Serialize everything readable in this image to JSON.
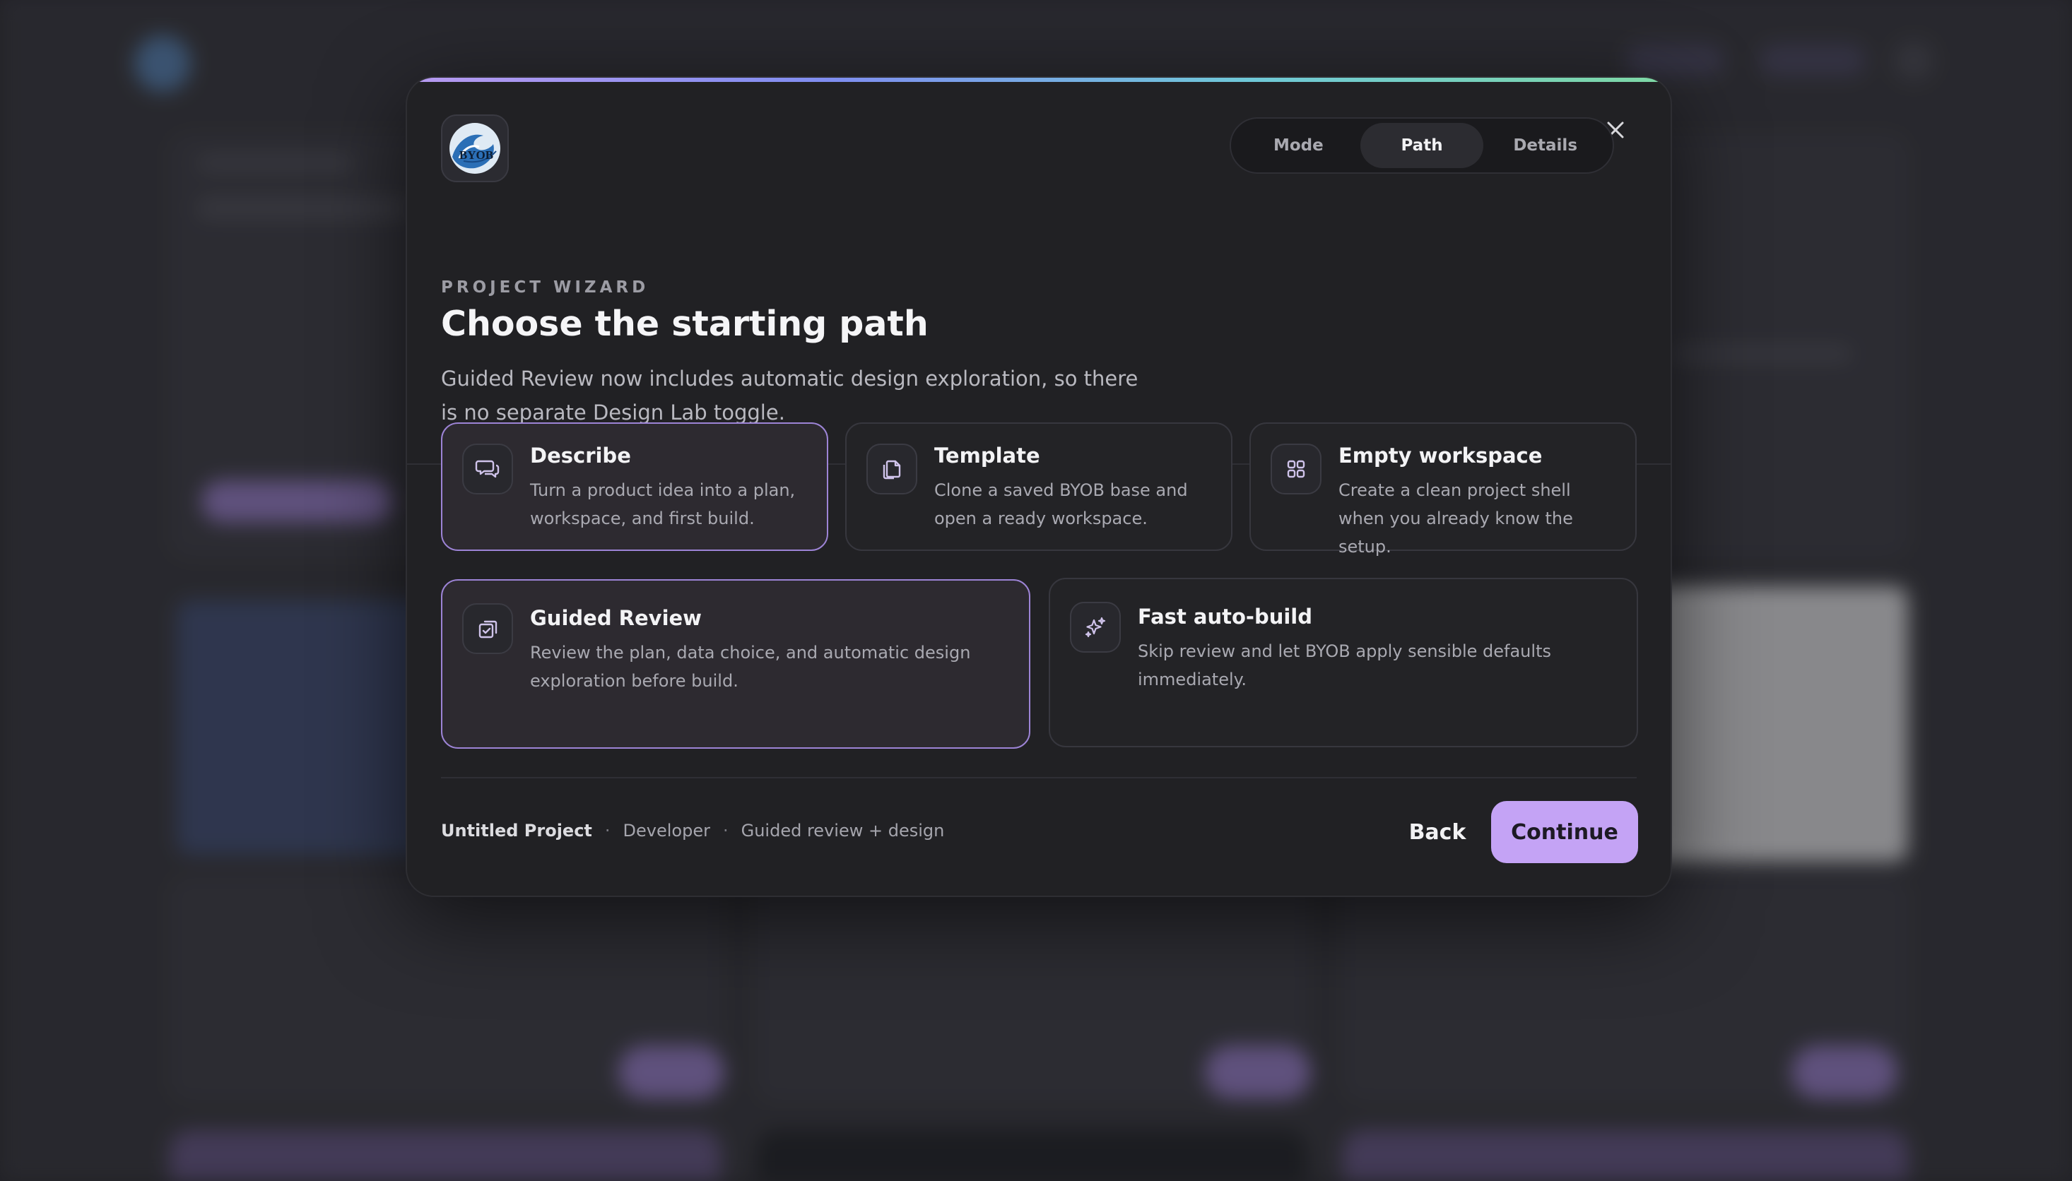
{
  "wizard": {
    "logo_text": "BYOB",
    "steps": [
      {
        "label": "Mode",
        "active": false
      },
      {
        "label": "Path",
        "active": true
      },
      {
        "label": "Details",
        "active": false
      }
    ],
    "eyebrow": "PROJECT WIZARD",
    "title": "Choose the starting path",
    "subtitle": "Guided Review now includes automatic design exploration, so there is no separate Design Lab toggle.",
    "sources": [
      {
        "title": "Describe",
        "description": "Turn a product idea into a plan, workspace, and first build.",
        "icon": "chat-bubbles-icon",
        "selected": true
      },
      {
        "title": "Template",
        "description": "Clone a saved BYOB base and open a ready workspace.",
        "icon": "copy-files-icon",
        "selected": false
      },
      {
        "title": "Empty workspace",
        "description": "Create a clean project shell when you already know the setup.",
        "icon": "grid-icon",
        "selected": false
      }
    ],
    "build_modes": [
      {
        "title": "Guided Review",
        "description": "Review the plan, data choice, and automatic design exploration before build.",
        "icon": "clipboard-check-icon",
        "selected": true
      },
      {
        "title": "Fast auto-build",
        "description": "Skip review and let BYOB apply sensible defaults immediately.",
        "icon": "sparkles-icon",
        "selected": false
      }
    ],
    "summary": {
      "project": "Untitled Project",
      "role": "Developer",
      "mode": "Guided review + design"
    },
    "back_label": "Back",
    "continue_label": "Continue"
  },
  "colors": {
    "accent": "#c4a3f5",
    "selected_border": "#9d84d6",
    "modal_bg": "#212124"
  }
}
